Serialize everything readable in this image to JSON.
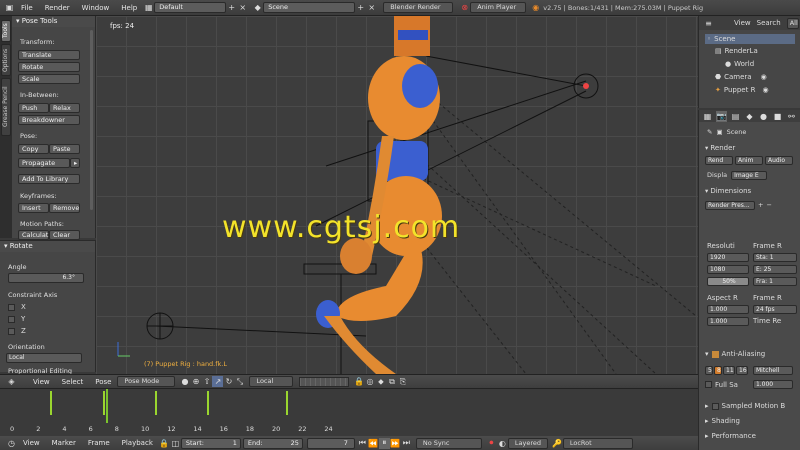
{
  "topbar": {
    "menus": [
      "File",
      "Render",
      "Window",
      "Help"
    ],
    "layout": "Default",
    "scene": "Scene",
    "engine": "Blender Render",
    "anim_player": "Anim Player",
    "info": "v2.75 | Bones:1/431 | Mem:275.03M | Puppet Rig"
  },
  "vtabs": [
    "Tools",
    "Options",
    "Grease Pencil"
  ],
  "toolshelf": {
    "title": "Pose Tools",
    "transform_label": "Transform:",
    "translate": "Translate",
    "rotate": "Rotate",
    "scale": "Scale",
    "inbetween_label": "In-Between:",
    "push": "Push",
    "relax": "Relax",
    "breakdowner": "Breakdowner",
    "pose_label": "Pose:",
    "copy": "Copy",
    "paste": "Paste",
    "propagate": "Propagate",
    "add_library": "Add To Library",
    "keyframes_label": "Keyframes:",
    "insert": "Insert",
    "remove": "Remove",
    "motion_label": "Motion Paths:",
    "calculate": "Calculat",
    "clear": "Clear"
  },
  "redo": {
    "title": "Rotate",
    "angle_label": "Angle",
    "angle_value": "6.3°",
    "constraint_label": "Constraint Axis",
    "axes": [
      "X",
      "Y",
      "Z"
    ],
    "orientation_label": "Orientation",
    "orientation_value": "Local",
    "proportional": "Proportional Editing"
  },
  "viewport": {
    "fps": "fps: 24",
    "object_label": "(7) Puppet Rig : hand.fk.L",
    "watermark": "www.cgtsj.com"
  },
  "outliner": {
    "view": "View",
    "search": "Search",
    "all": "All",
    "items": [
      "Scene",
      "RenderLa",
      "World",
      "Camera",
      "Puppet R"
    ]
  },
  "props": {
    "scene": "Scene",
    "render_title": "Render",
    "render_btns": [
      "Rend",
      "Anim",
      "Audio"
    ],
    "display_label": "Displa",
    "display_value": "Image E",
    "dimensions_title": "Dimensions",
    "preset": "Render Pres...",
    "resolution_label": "Resoluti",
    "res_x": "1920",
    "res_y": "1080",
    "res_pct": "50%",
    "frame_range_label": "Frame R",
    "start": "Sta: 1",
    "end": "E: 25",
    "step": "Fra: 1",
    "aspect_label": "Aspect R",
    "asp_x": "1.000",
    "asp_y": "1.000",
    "frame_rate_label": "Frame R",
    "fps_value": "24 fps",
    "time_label": "Time Re",
    "aa_title": "Anti-Aliasing",
    "aa_samples": [
      "5",
      "8",
      "11",
      "16"
    ],
    "aa_filter": "Mitchell",
    "full_sample": "Full Sa",
    "aa_size": "1.000",
    "motion_blur": "Sampled Motion B",
    "shading": "Shading",
    "performance": "Performance"
  },
  "vp_header": {
    "view": "View",
    "select": "Select",
    "pose": "Pose",
    "mode": "Pose Mode",
    "orientation": "Local"
  },
  "timeline": {
    "labels": [
      "0",
      "2",
      "4",
      "6",
      "8",
      "10",
      "12",
      "14",
      "16",
      "18",
      "20",
      "22",
      "24"
    ],
    "keyframes": [
      2,
      6,
      10,
      14,
      20
    ],
    "current_frame": 7
  },
  "tl_header": {
    "view": "View",
    "marker": "Marker",
    "frame": "Frame",
    "playback": "Playback",
    "start_label": "Start:",
    "start_value": "1",
    "end_label": "End:",
    "end_value": "25",
    "current": "7",
    "sync": "No Sync",
    "keyset": "Layered",
    "keying": "LocRot"
  }
}
